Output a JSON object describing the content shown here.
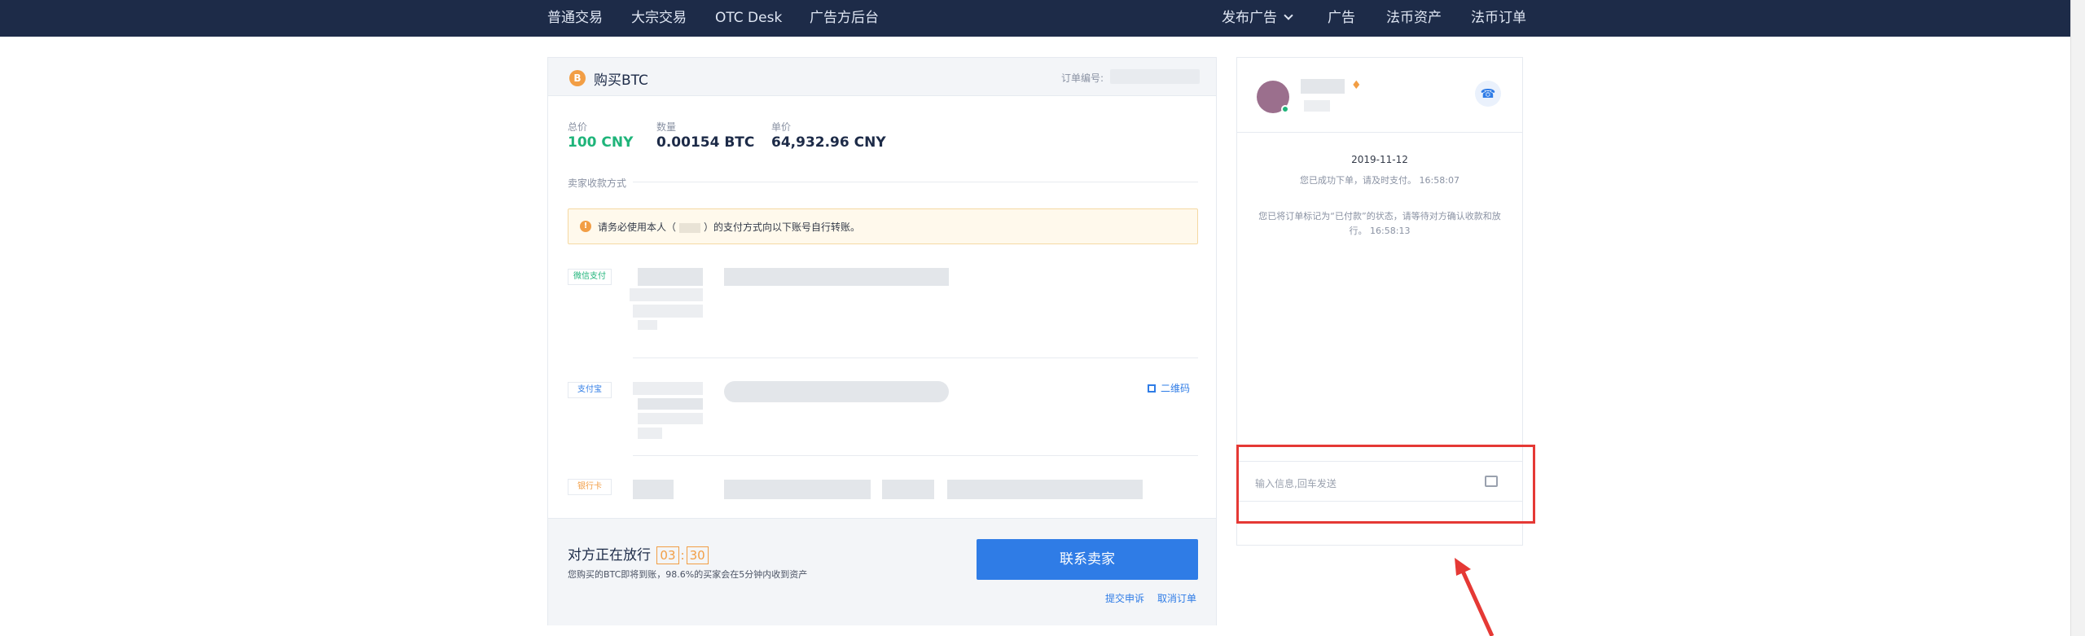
{
  "nav": {
    "left": [
      "普通交易",
      "大宗交易",
      "OTC Desk",
      "广告方后台"
    ],
    "right": [
      "发布广告",
      "广告",
      "法币资产",
      "法币订单"
    ]
  },
  "order": {
    "coin_symbol": "B",
    "title": "购买BTC",
    "order_no_label": "订单编号:",
    "total_label": "总价",
    "total_value": "100 CNY",
    "qty_label": "数量",
    "qty_value": "0.00154 BTC",
    "price_label": "单价",
    "price_value": "64,932.96 CNY",
    "method_label": "卖家收款方式",
    "notice_before": "请务必使用本人（",
    "notice_after": "）的支付方式向以下账号自行转账。",
    "methods": [
      {
        "name": "微信支付",
        "color": "#1fb47a"
      },
      {
        "name": "支付宝",
        "color": "#2f7ce6"
      },
      {
        "name": "银行卡",
        "color": "#f29e45"
      }
    ],
    "qr_label": "二维码",
    "release_title": "对方正在放行",
    "timer_min": "03",
    "timer_sec": "30",
    "release_desc": "您购买的BTC即将到账，98.6%的买家会在5分钟内收到资产",
    "contact_button": "联系卖家",
    "appeal_link": "提交申诉",
    "cancel_link": "取消订单"
  },
  "chat": {
    "date": "2019-11-12",
    "msg1": "您已成功下单，请及时支付。 16:58:07",
    "msg2": "您已将订单标记为“已付款”的状态，请等待对方确认收款和放行。 16:58:13",
    "input_placeholder": "输入信息,回车发送",
    "phone_icon": "phone-icon",
    "vip_icon": "diamond-icon"
  },
  "colors": {
    "nav_bg": "#1d2b48",
    "accent_blue": "#2f7ce6",
    "accent_green": "#1fb47a",
    "accent_orange": "#f29e45",
    "highlight_red": "#e53935"
  }
}
